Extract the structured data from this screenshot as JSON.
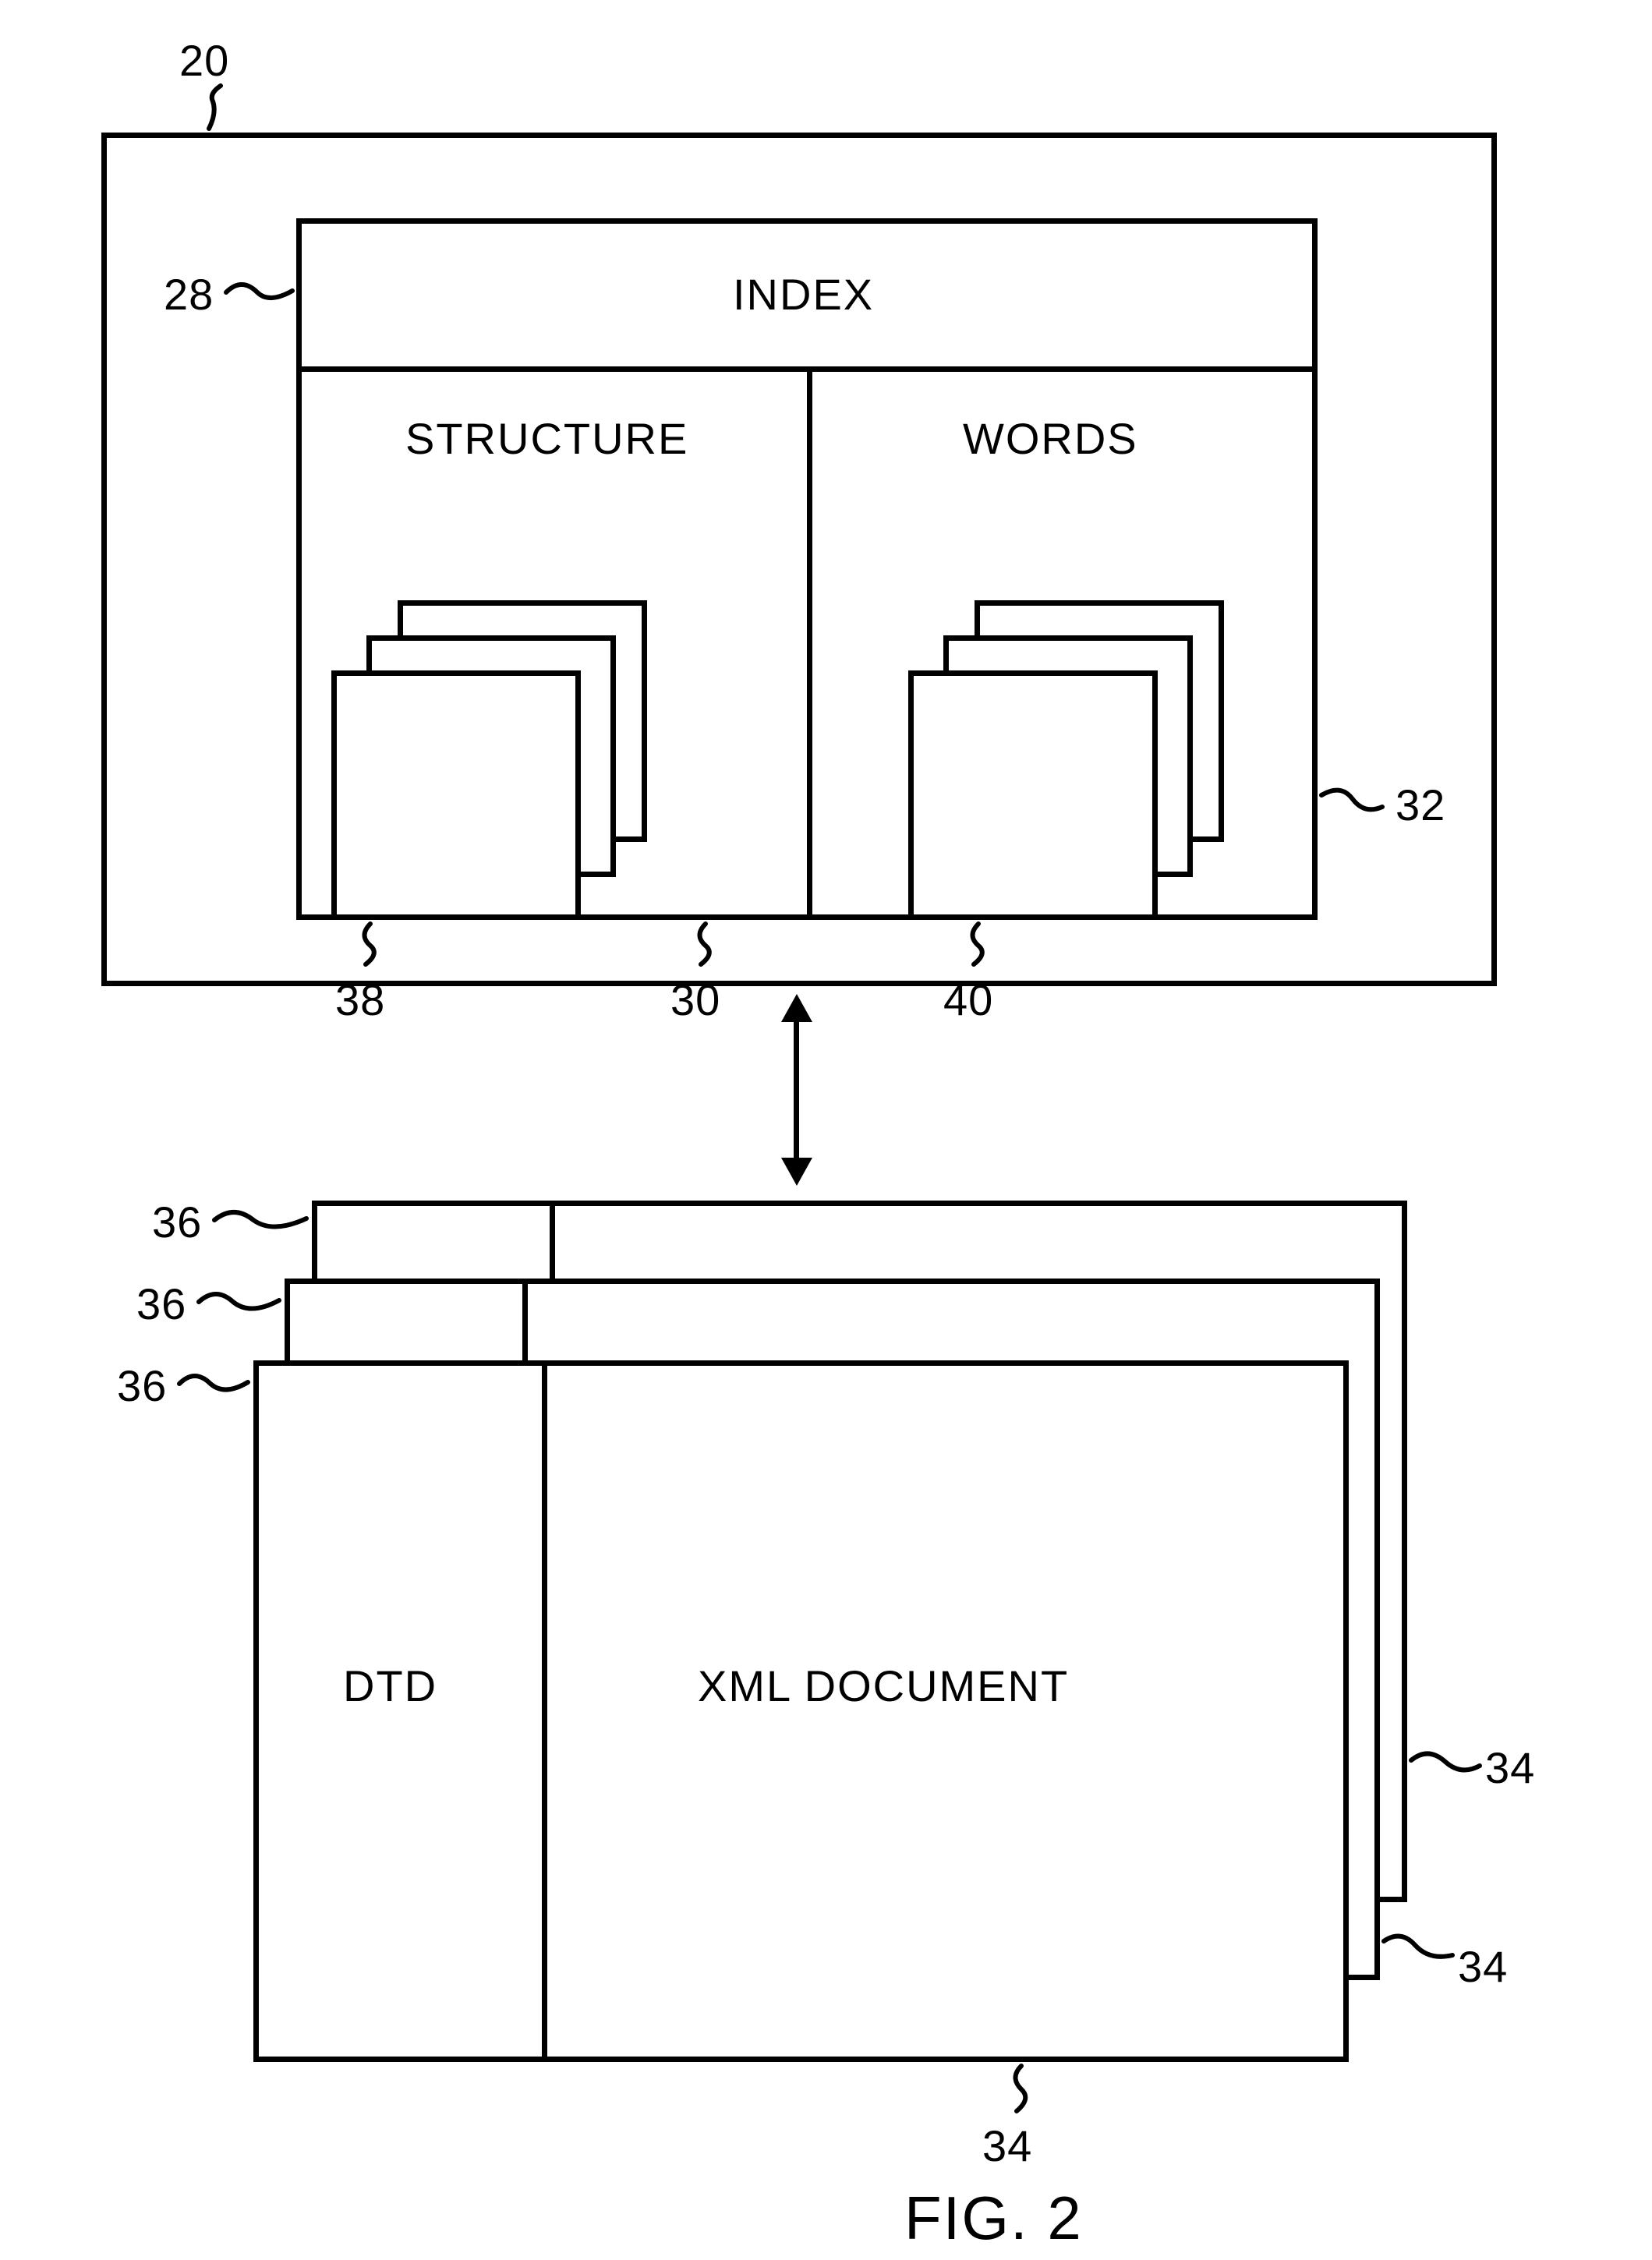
{
  "refs": {
    "r20": "20",
    "r28": "28",
    "r30": "30",
    "r32": "32",
    "r34a": "34",
    "r34b": "34",
    "r34c": "34",
    "r36a": "36",
    "r36b": "36",
    "r36c": "36",
    "r38": "38",
    "r40": "40"
  },
  "labels": {
    "index": "INDEX",
    "structure": "STRUCTURE",
    "words": "WORDS",
    "dtd": "DTD",
    "xml": "XML DOCUMENT"
  },
  "figure": "FIG. 2",
  "chart_data": {
    "type": "diagram",
    "title": "FIG. 2",
    "nodes": [
      {
        "id": 20,
        "label": "",
        "role": "outer container"
      },
      {
        "id": 28,
        "label": "INDEX",
        "parent": 20
      },
      {
        "id": 30,
        "label": "STRUCTURE",
        "parent": 28
      },
      {
        "id": 32,
        "label": "WORDS",
        "parent": 28
      },
      {
        "id": 38,
        "label": "",
        "role": "stacked files under STRUCTURE",
        "parent": 30
      },
      {
        "id": 40,
        "label": "",
        "role": "stacked files under WORDS",
        "parent": 32
      },
      {
        "id": 34,
        "label": "XML DOCUMENT",
        "role": "stacked document (×3)"
      },
      {
        "id": 36,
        "label": "DTD",
        "role": "DTD panel on each document (×3)"
      }
    ],
    "edges": [
      {
        "from": 20,
        "to": 34,
        "style": "double-arrow"
      }
    ]
  }
}
